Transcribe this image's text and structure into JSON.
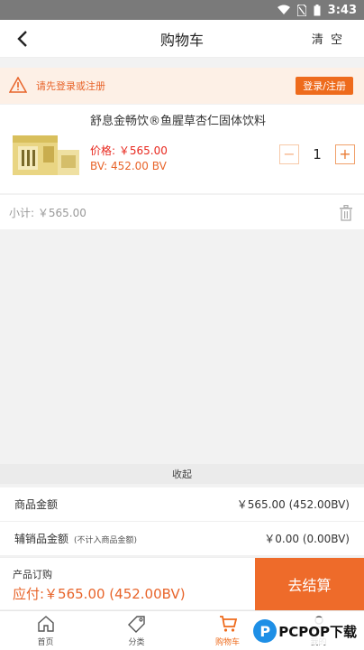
{
  "status_bar": {
    "time": "3:43"
  },
  "header": {
    "title": "购物车",
    "clear_label": "清 空"
  },
  "notice": {
    "text": "请先登录或注册",
    "button_label": "登录/注册"
  },
  "cart_item": {
    "name": "舒息金畅饮®鱼腥草杏仁固体饮料",
    "price_label": "价格: ￥565.00",
    "bv_label": "BV: 452.00 BV",
    "quantity": "1",
    "minus": "−",
    "plus": "+"
  },
  "subtotal": {
    "text": "小计: ￥565.00"
  },
  "collapse_label": "收起",
  "summary": {
    "product_amount_label": "商品金额",
    "product_amount_value": "￥565.00 (452.00BV)",
    "accessory_amount_label": "辅销品金额",
    "accessory_amount_note": "(不计入商品金额)",
    "accessory_amount_value": "￥0.00 (0.00BV)"
  },
  "order_bar": {
    "label": "产品订购",
    "payable": "应付:￥565.00 (452.00BV)",
    "checkout_label": "去结算"
  },
  "tabs": [
    {
      "label": "首页",
      "icon": "home-icon"
    },
    {
      "label": "分类",
      "icon": "tag-icon"
    },
    {
      "label": "购物车",
      "icon": "cart-icon"
    },
    {
      "label": "我的",
      "icon": "user-icon"
    }
  ],
  "colors": {
    "accent": "#ee6b1c",
    "price_red": "#e8281e",
    "notice_bg": "#fdf0e6"
  },
  "watermark": {
    "letter": "P",
    "text": "PCPOP下载"
  }
}
